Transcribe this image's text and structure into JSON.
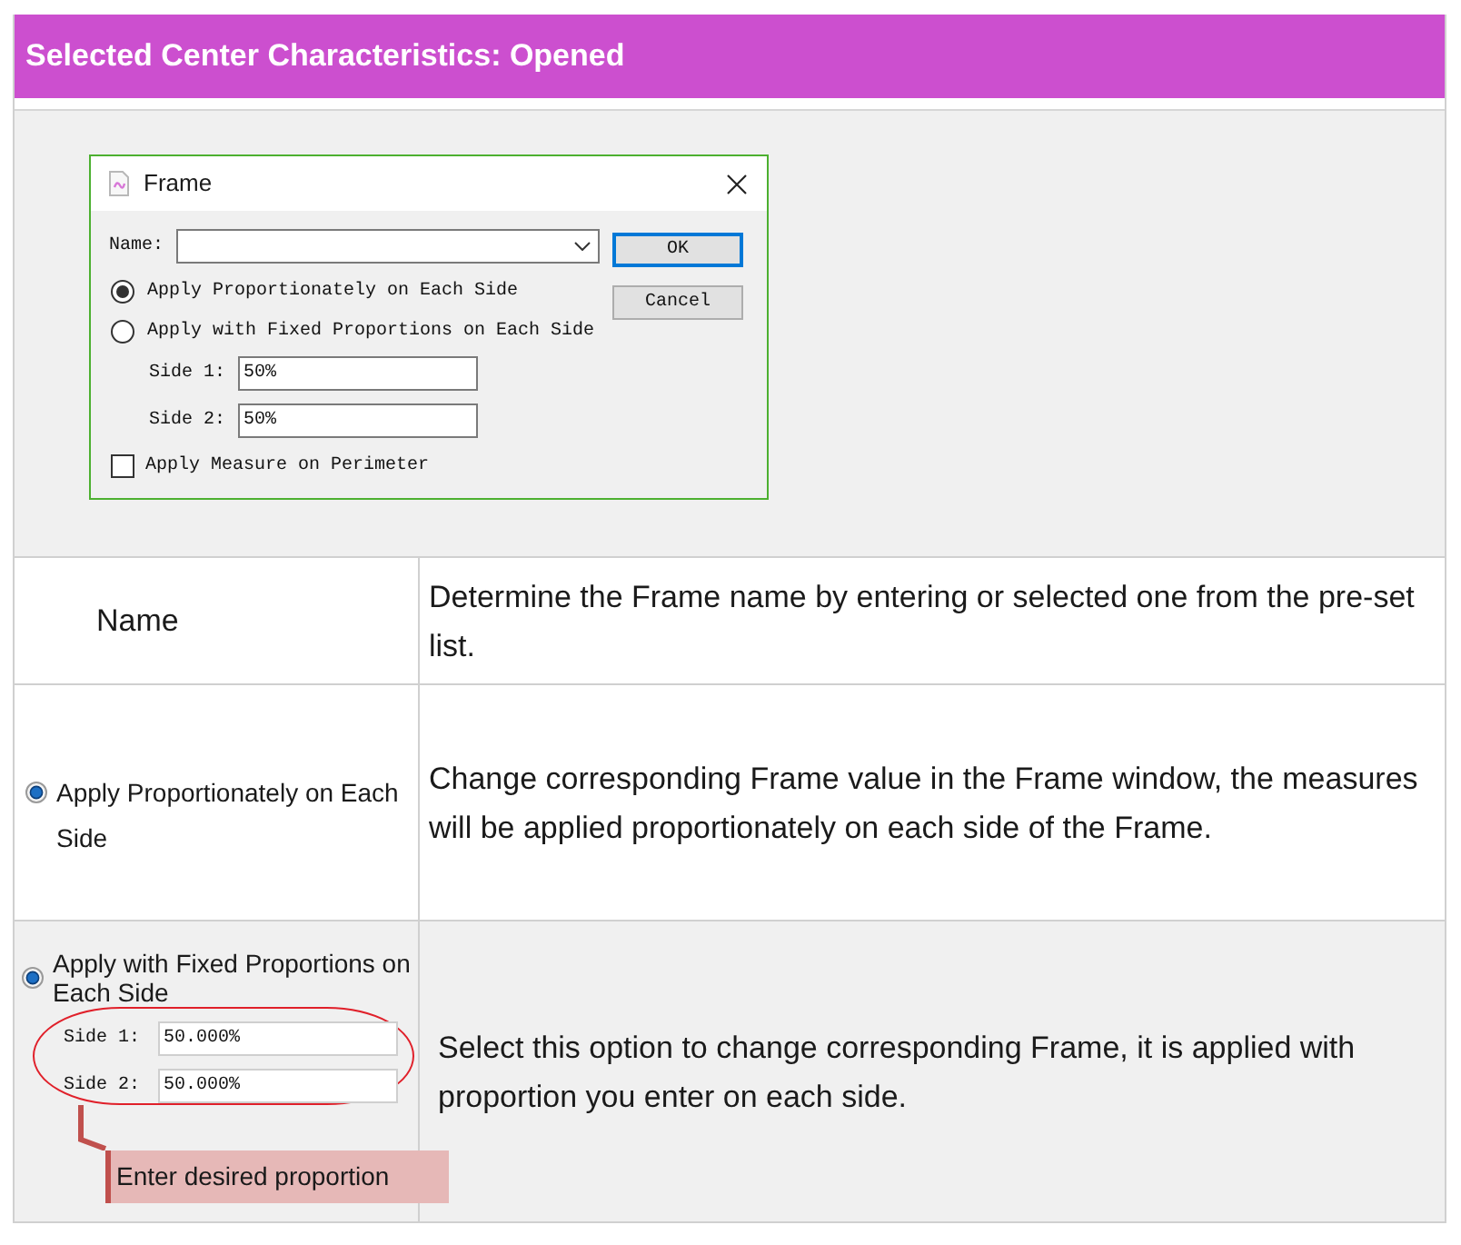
{
  "header": {
    "title": "Selected Center Characteristics: Opened"
  },
  "dialog": {
    "title": "Frame",
    "name_label": "Name:",
    "options": [
      {
        "label": "Apply Proportionately on Each Side",
        "selected": true
      },
      {
        "label": "Apply with Fixed Proportions on Each Side",
        "selected": false
      }
    ],
    "sides": [
      {
        "label": "Side 1:",
        "value": "50%"
      },
      {
        "label": "Side 2:",
        "value": "50%"
      }
    ],
    "checkbox": {
      "label": "Apply Measure on Perimeter",
      "checked": false
    },
    "buttons": [
      {
        "label": "OK",
        "default": true
      },
      {
        "label": "Cancel",
        "default": false
      }
    ]
  },
  "rows": [
    {
      "kind": "text",
      "label": "Name",
      "description": "Determine the Frame name by entering or selected one from the pre-set list."
    },
    {
      "kind": "radio",
      "label": "Apply Proportionately on Each Side",
      "selected": true,
      "description": "Change corresponding Frame value in the Frame window, the measures will be applied proportionately on each side of the Frame."
    },
    {
      "kind": "radio_fields",
      "label": "Apply with Fixed Proportions on Each Side",
      "selected": true,
      "fields": [
        {
          "label": "Side 1:",
          "value": "50.000%"
        },
        {
          "label": "Side 2:",
          "value": "50.000%"
        }
      ],
      "callout": "Enter desired proportion",
      "description": "Select this option to change corresponding Frame, it is applied with proportion you enter on each side."
    }
  ]
}
